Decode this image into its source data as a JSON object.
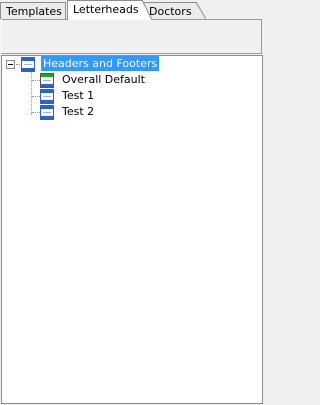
{
  "tabs": [
    {
      "label": "Templates"
    },
    {
      "label": "Letterheads",
      "active": true
    },
    {
      "label": "Doctors"
    }
  ],
  "tree": {
    "root": {
      "label": "Headers and Footers",
      "icon": "header-footer-icon",
      "expanded": true,
      "selected": true
    },
    "children": [
      {
        "label": "Overall Default",
        "icon": "default-letterhead-icon"
      },
      {
        "label": "Test 1",
        "icon": "letterhead-icon"
      },
      {
        "label": "Test 2",
        "icon": "letterhead-icon"
      }
    ]
  },
  "colors": {
    "selection": "#3399ff",
    "icon_blue": "#2a64c8",
    "icon_green": "#22a02a"
  }
}
